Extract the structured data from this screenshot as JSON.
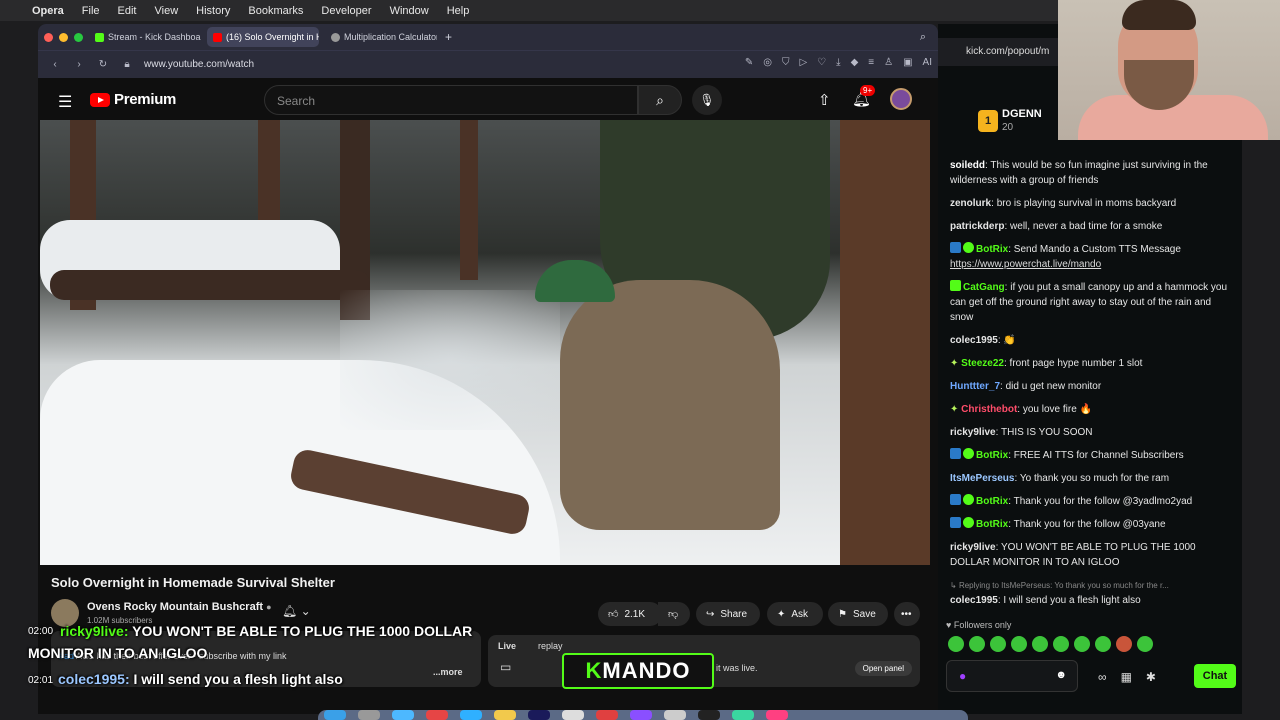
{
  "menubar": {
    "app": "Opera",
    "items": [
      "File",
      "Edit",
      "View",
      "History",
      "Bookmarks",
      "Developer",
      "Window",
      "Help"
    ]
  },
  "tabs": [
    {
      "label": "Stream - Kick Dashboard",
      "color": "#53fc18"
    },
    {
      "label": "(16) Solo Overnight in Ho",
      "color": "#ff0000",
      "active": true
    },
    {
      "label": "Multiplication Calculator",
      "color": "#aaaaaa"
    }
  ],
  "address": {
    "url": "www.youtube.com/watch",
    "ai_label": "AI"
  },
  "youtube": {
    "logo": "Premium",
    "search_placeholder": "Search",
    "notif_badge": "9+",
    "video_title": "Solo Overnight in Homemade Survival Shelter",
    "channel": "Ovens Rocky Mountain Bushcraft",
    "subs": "1.02M subscribers",
    "likes": "2.1K",
    "share": "Share",
    "ask": "Ask",
    "save": "Save",
    "desc_tags": "#ad",
    "desc_text": "AG1 has their best offer ever - subscribe with my link",
    "desc_more": "...more",
    "live_label": "Live",
    "live_text": "replay",
    "live_text2": "it was live.",
    "open_panel": "Open panel"
  },
  "chat": {
    "url": "kick.com/popout/m",
    "top_rank": "1",
    "top_name": "DGENN",
    "top_count": "20",
    "messages": [
      {
        "user": "soiledd",
        "color": "#ffffff",
        "text": "This would be so fun imagine just surviving in the wilderness with a group of friends"
      },
      {
        "user": "zenolurk",
        "color": "#ffffff",
        "text": "bro is playing survival in moms backyard"
      },
      {
        "user": "patrickderp",
        "color": "#ffffff",
        "text": "well, never a bad time for a smoke"
      },
      {
        "user": "BotRix",
        "color": "#53fc18",
        "text": "Send Mando a Custom TTS Message",
        "link": "https://www.powerchat.live/mando",
        "bot": true
      },
      {
        "user": "CatGang",
        "color": "#53fc18",
        "text": "if you put a small canopy up and a hammock you can get off the ground right away to stay out of the rain and snow"
      },
      {
        "user": "colec1995",
        "color": "#ffffff",
        "text": "👏"
      },
      {
        "user": "Steeze22",
        "color": "#53fc18",
        "text": "front page hype number 1 slot"
      },
      {
        "user": "Hunttter_7",
        "color": "#6fa8ff",
        "text": "did u get new monitor"
      },
      {
        "user": "Christhebot",
        "color": "#ff4d6a",
        "text": "you love fire 🔥"
      },
      {
        "user": "ricky9live",
        "color": "#ffffff",
        "text": "THIS IS YOU SOON"
      },
      {
        "user": "BotRix",
        "color": "#53fc18",
        "text": "FREE AI TTS for Channel Subscribers",
        "bot": true
      },
      {
        "user": "ItsMePerseus",
        "color": "#9bc7ff",
        "text": "Yo thank you so much for the ram"
      },
      {
        "user": "BotRix",
        "color": "#53fc18",
        "text": "Thank you for the follow @3yadlmo2yad",
        "bot": true
      },
      {
        "user": "BotRix",
        "color": "#53fc18",
        "text": "Thank you for the follow @03yane",
        "bot": true
      },
      {
        "user": "ricky9live",
        "color": "#ffffff",
        "text": "YOU WON'T BE ABLE TO PLUG THE 1000 DOLLAR MONITOR IN TO AN IGLOO"
      },
      {
        "user": "colec1995",
        "color": "#ffffff",
        "text": "I will send you a flesh light also",
        "reply": "Replying to ItsMePerseus: Yo thank you so much for the r..."
      }
    ],
    "followers_only": "Followers only",
    "send": "Chat"
  },
  "overlay": {
    "time1": "02:00",
    "line1_user": "ricky9live:",
    "line1_text": "YOU WON'T BE ABLE TO PLUG THE 1000 DOLLAR",
    "line2_text": "MONITOR IN TO AN IGLOO",
    "time2": "02:01",
    "line3_user": "colec1995:",
    "line3_text": "I will send you a flesh light also",
    "mando_k": "K",
    "mando_text": "MANDO"
  }
}
